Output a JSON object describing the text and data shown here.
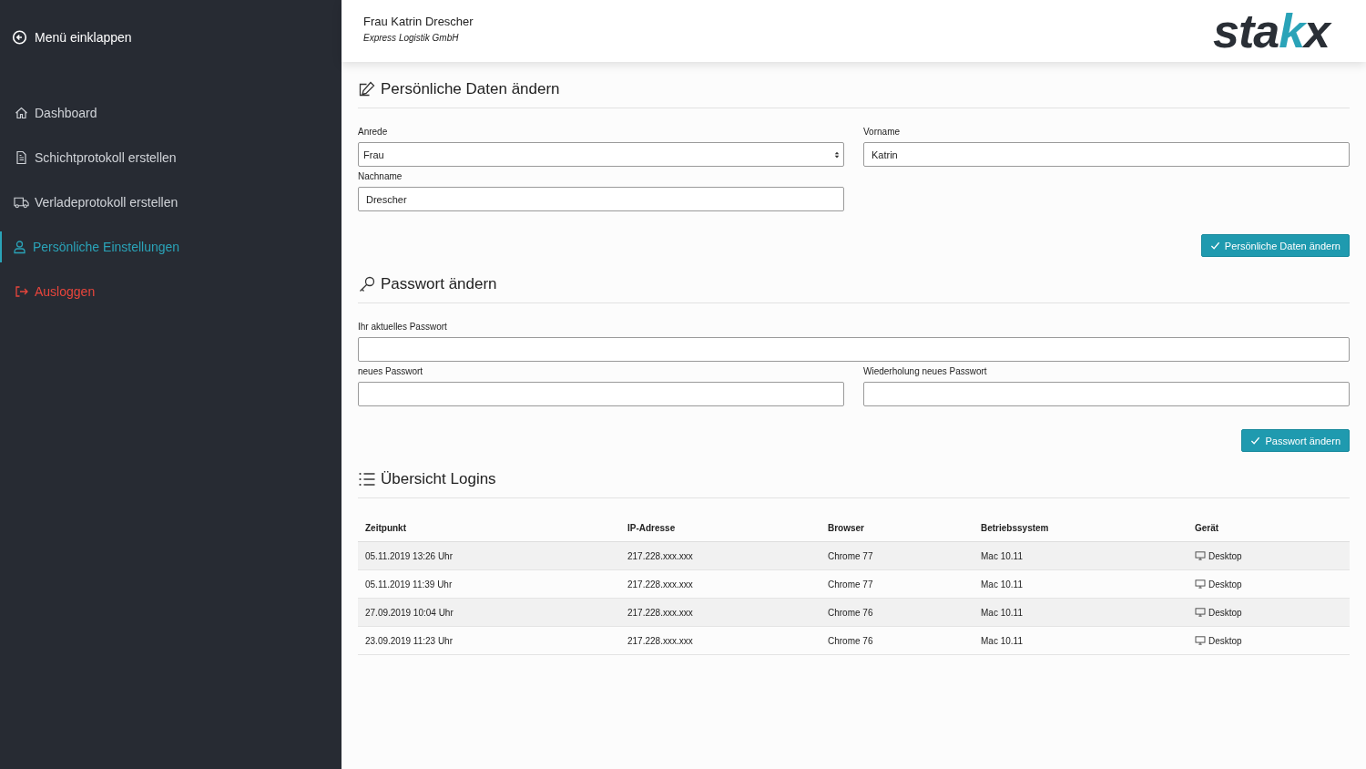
{
  "sidebar": {
    "collapse": {
      "label": "Menü einklappen"
    },
    "items": [
      {
        "kind": "home",
        "label": "Dashboard",
        "selected": false
      },
      {
        "kind": "document",
        "label": "Schichtprotokoll erstellen",
        "selected": false
      },
      {
        "kind": "truck",
        "label": "Verladeprotokoll erstellen",
        "selected": false
      },
      {
        "kind": "user",
        "label": "Persönliche Einstellungen",
        "selected": true
      },
      {
        "kind": "logout",
        "label": "Ausloggen",
        "selected": false
      }
    ]
  },
  "header": {
    "user_name": "Frau Katrin Drescher",
    "company": "Express Logistik GmbH",
    "logo": {
      "before": "sta",
      "accent": "k",
      "after": "x"
    }
  },
  "personal": {
    "title": "Persönliche Daten ändern",
    "fields": [
      {
        "kind": "select",
        "label": "Anrede",
        "value": "Frau"
      },
      {
        "kind": "text",
        "label": "Vorname",
        "value": "Katrin"
      },
      {
        "kind": "text",
        "label": "Nachname",
        "value": "Drescher"
      }
    ],
    "button": "Persönliche Daten ändern"
  },
  "password": {
    "title": "Passwort ändern",
    "current_label": "Ihr aktuelles Passwort",
    "new_label": "neues Passwort",
    "repeat_label": "Wiederholung neues Passwort",
    "button": "Passwort ändern"
  },
  "logins": {
    "title": "Übersicht Logins",
    "columns": [
      "Zeitpunkt",
      "IP-Adresse",
      "Browser",
      "Betriebssystem",
      "Gerät"
    ],
    "rows": [
      [
        "05.11.2019 13:26 Uhr",
        "217.228.xxx.xxx",
        "Chrome 77",
        "Mac 10.11",
        "Desktop"
      ],
      [
        "05.11.2019 11:39 Uhr",
        "217.228.xxx.xxx",
        "Chrome 77",
        "Mac 10.11",
        "Desktop"
      ],
      [
        "27.09.2019 10:04 Uhr",
        "217.228.xxx.xxx",
        "Chrome 76",
        "Mac 10.11",
        "Desktop"
      ],
      [
        "23.09.2019 11:23 Uhr",
        "217.228.xxx.xxx",
        "Chrome 76",
        "Mac 10.11",
        "Desktop"
      ]
    ]
  }
}
